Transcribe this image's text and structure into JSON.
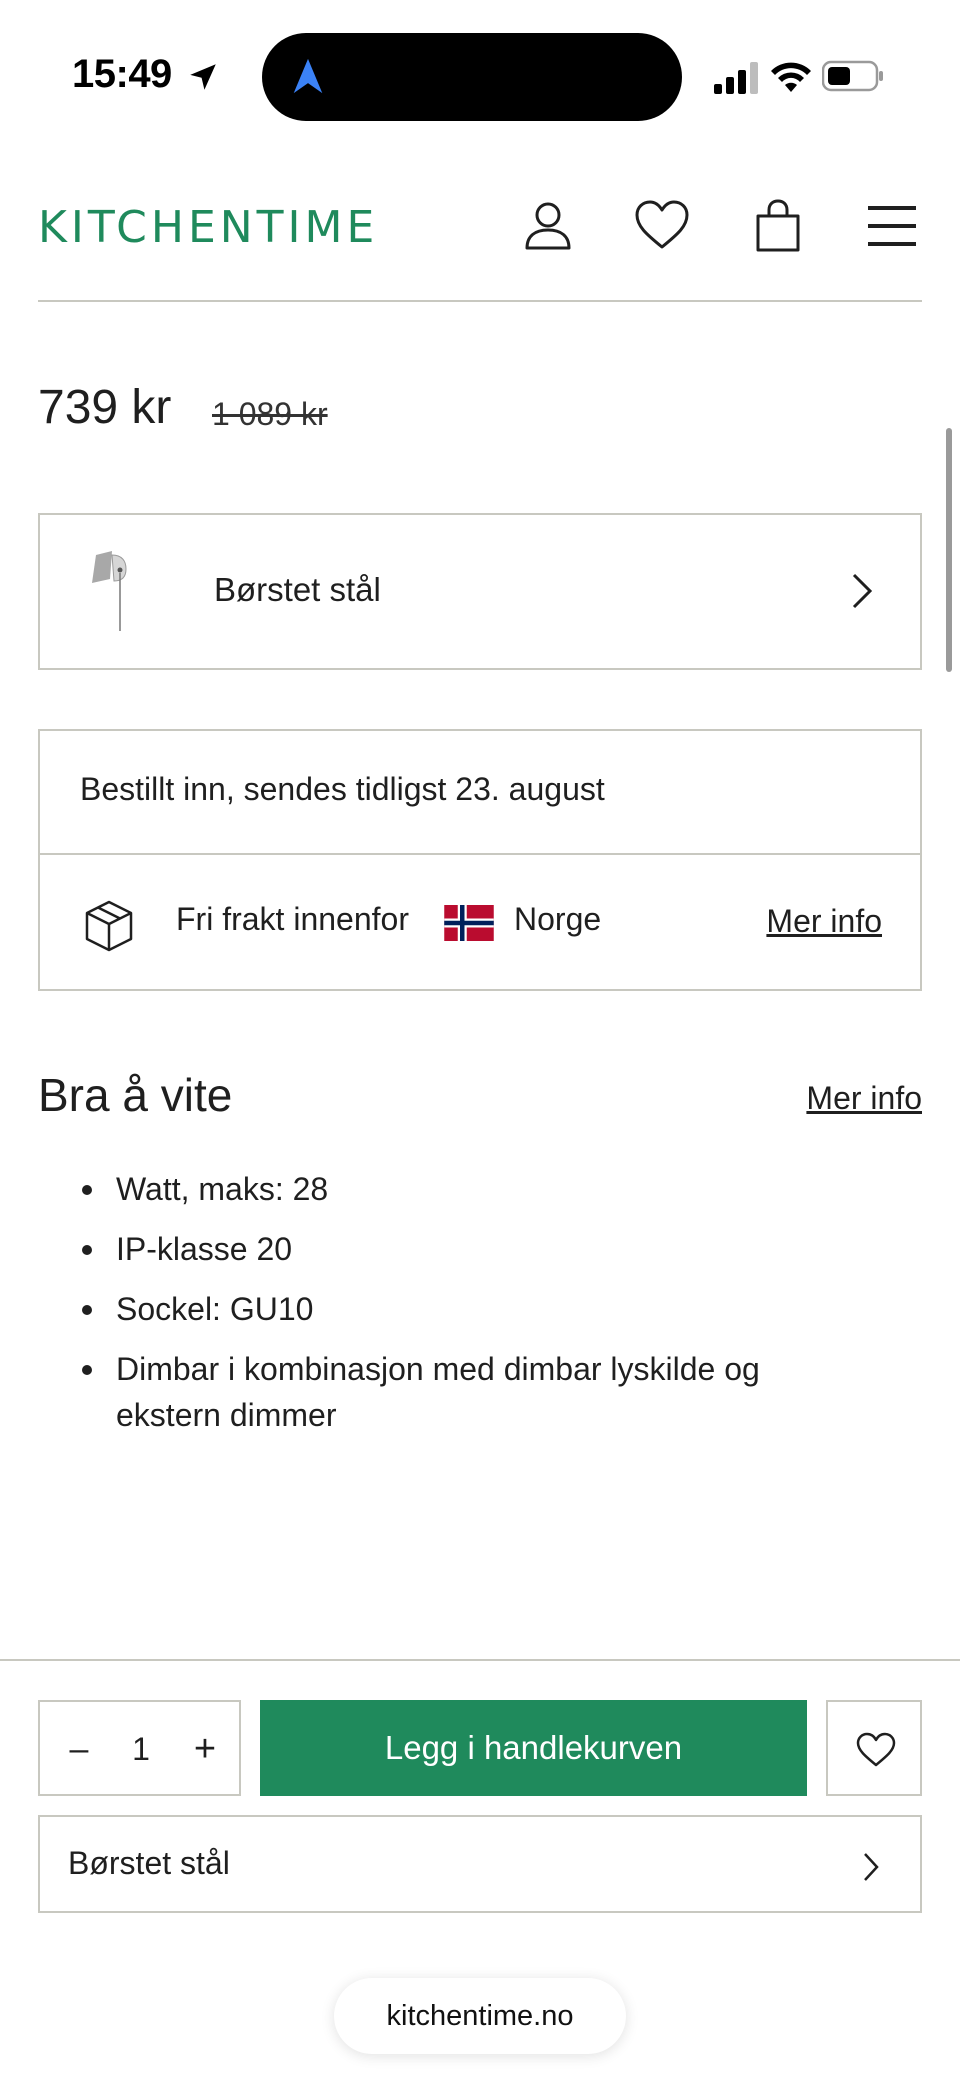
{
  "status_bar": {
    "time": "15:49"
  },
  "header": {
    "logo_text": "KITCHENTIME",
    "brand_color": "#1f8a5c",
    "icons": [
      "user-icon",
      "heart-icon",
      "bag-icon",
      "menu-icon"
    ]
  },
  "product": {
    "price_current": "739 kr",
    "price_original": "1 089 kr",
    "variant": {
      "label": "Børstet stål"
    }
  },
  "delivery": {
    "status": "Bestillt inn, sendes tidligst 23. august",
    "shipping_text": "Fri frakt innenfor",
    "country": "Norge",
    "more_info": "Mer info"
  },
  "good_to_know": {
    "title": "Bra å vite",
    "more_info": "Mer info",
    "features": [
      "Watt, maks: 28",
      "IP-klasse 20",
      "Sockel: GU10",
      "Dimbar i kombinasjon med dimbar lyskilde og ekstern dimmer"
    ]
  },
  "action_bar": {
    "qty_minus": "–",
    "quantity": "1",
    "qty_plus": "+",
    "add_to_cart": "Legg i handlekurven",
    "variant_label": "Børstet stål"
  },
  "browser": {
    "url": "kitchentime.no"
  }
}
